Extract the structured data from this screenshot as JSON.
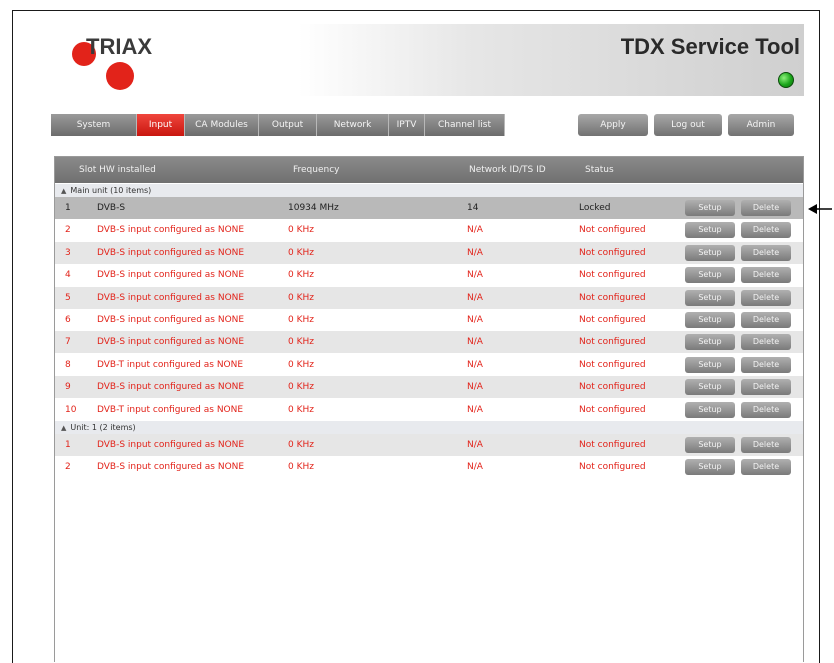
{
  "header": {
    "logo_text": "TRIAX",
    "app_title": "TDX Service Tool"
  },
  "nav": {
    "tabs": [
      {
        "label": "System",
        "active": false
      },
      {
        "label": "Input",
        "active": true
      },
      {
        "label": "CA Modules",
        "active": false
      },
      {
        "label": "Output",
        "active": false
      },
      {
        "label": "Network",
        "active": false
      },
      {
        "label": "IPTV",
        "active": false
      },
      {
        "label": "Channel list",
        "active": false
      }
    ],
    "actions": [
      "Apply",
      "Log out",
      "Admin"
    ]
  },
  "grid": {
    "columns": [
      "Slot HW installed",
      "Frequency",
      "Network ID/TS ID",
      "Status"
    ],
    "row_buttons": {
      "setup": "Setup",
      "delete": "Delete"
    },
    "groups": [
      {
        "label": "Main unit (10 items)",
        "rows": [
          {
            "slot": "1",
            "hw": "DVB-S",
            "freq": "10934 MHz",
            "netid": "14",
            "status": "Locked",
            "error": false,
            "selected": true
          },
          {
            "slot": "2",
            "hw": "DVB-S input configured as NONE",
            "freq": "0 KHz",
            "netid": "N/A",
            "status": "Not configured",
            "error": true
          },
          {
            "slot": "3",
            "hw": "DVB-S input configured as NONE",
            "freq": "0 KHz",
            "netid": "N/A",
            "status": "Not configured",
            "error": true
          },
          {
            "slot": "4",
            "hw": "DVB-S input configured as NONE",
            "freq": "0 KHz",
            "netid": "N/A",
            "status": "Not configured",
            "error": true
          },
          {
            "slot": "5",
            "hw": "DVB-S input configured as NONE",
            "freq": "0 KHz",
            "netid": "N/A",
            "status": "Not configured",
            "error": true
          },
          {
            "slot": "6",
            "hw": "DVB-S input configured as NONE",
            "freq": "0 KHz",
            "netid": "N/A",
            "status": "Not configured",
            "error": true
          },
          {
            "slot": "7",
            "hw": "DVB-S input configured as NONE",
            "freq": "0 KHz",
            "netid": "N/A",
            "status": "Not configured",
            "error": true
          },
          {
            "slot": "8",
            "hw": "DVB-T input configured as NONE",
            "freq": "0 KHz",
            "netid": "N/A",
            "status": "Not configured",
            "error": true
          },
          {
            "slot": "9",
            "hw": "DVB-S input configured as NONE",
            "freq": "0 KHz",
            "netid": "N/A",
            "status": "Not configured",
            "error": true
          },
          {
            "slot": "10",
            "hw": "DVB-T input configured as NONE",
            "freq": "0 KHz",
            "netid": "N/A",
            "status": "Not configured",
            "error": true
          }
        ]
      },
      {
        "label": "Unit: 1 (2 items)",
        "rows": [
          {
            "slot": "1",
            "hw": "DVB-S input configured as NONE",
            "freq": "0 KHz",
            "netid": "N/A",
            "status": "Not configured",
            "error": true
          },
          {
            "slot": "2",
            "hw": "DVB-S input configured as NONE",
            "freq": "0 KHz",
            "netid": "N/A",
            "status": "Not configured",
            "error": true
          }
        ]
      }
    ]
  },
  "colors": {
    "brand_red": "#e2231a",
    "status_led": "#1aa51a",
    "error_text": "#e2231a"
  },
  "icons": {
    "status_led": "green-status-led-icon",
    "annotation": "left-arrow-icon",
    "group_toggle": "triangle-expand-icon"
  }
}
